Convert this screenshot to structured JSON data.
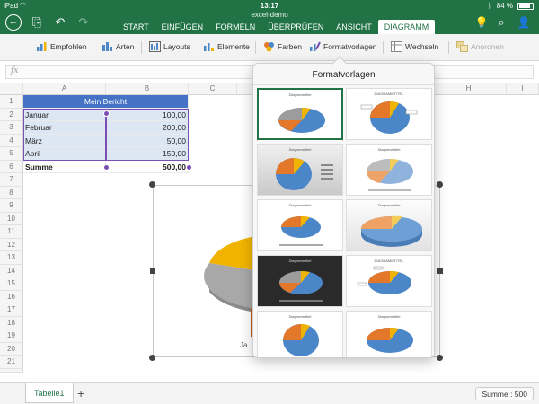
{
  "status": {
    "carrier": "iPad",
    "time": "13:17",
    "battery": "84 %"
  },
  "document": {
    "title": "excel-demo"
  },
  "tabs": [
    {
      "label": "START"
    },
    {
      "label": "EINFÜGEN"
    },
    {
      "label": "FORMELN"
    },
    {
      "label": "ÜBERPRÜFEN"
    },
    {
      "label": "ANSICHT"
    },
    {
      "label": "DIAGRAMM",
      "active": true
    }
  ],
  "ribbon": {
    "empfohlen": "Empfohlen",
    "arten": "Arten",
    "layouts": "Layouts",
    "elemente": "Elemente",
    "farben": "Farben",
    "formatvorlagen": "Formatvorlagen",
    "wechseln": "Wechseln",
    "anordnen": "Anordnen"
  },
  "formula_bar": {
    "fx": "fx",
    "value": ""
  },
  "columns": [
    "A",
    "B",
    "C",
    "D",
    "E",
    "F",
    "G",
    "H",
    "I"
  ],
  "rows": [
    "1",
    "2",
    "3",
    "4",
    "5",
    "6",
    "7",
    "8",
    "9",
    "10",
    "11",
    "12",
    "13",
    "14",
    "15",
    "16",
    "17",
    "18",
    "19",
    "20",
    "21",
    "22"
  ],
  "sheet": {
    "title": "Mein Bericht",
    "entries": [
      {
        "month": "Januar",
        "value": "100,00"
      },
      {
        "month": "Februar",
        "value": "200,00"
      },
      {
        "month": "März",
        "value": "50,00"
      },
      {
        "month": "April",
        "value": "150,00"
      }
    ],
    "sum_label": "Summe",
    "sum_value": "500,00"
  },
  "chart_legend_partial": "Ja",
  "popover": {
    "title": "Formatvorlagen",
    "styles": [
      {
        "caption": "Diagrammtitel"
      },
      {
        "caption": "DIAGRAMMTITEL"
      },
      {
        "caption": "Diagrammtitel"
      },
      {
        "caption": "Diagrammtitel"
      },
      {
        "caption": "Diagrammtitel"
      },
      {
        "caption": "Diagrammtitel"
      },
      {
        "caption": "Diagrammtitel"
      },
      {
        "caption": "DIAGRAMMTITEL"
      },
      {
        "caption": "Diagrammtitel"
      },
      {
        "caption": "Diagrammtitel"
      }
    ]
  },
  "bottom": {
    "sheet_tab": "Tabelle1",
    "add_sheet": "+",
    "sum_readout": "Summe : 500"
  },
  "colors": {
    "brand": "#217346",
    "header_fill": "#4472c4",
    "pie_blue": "#4a86c8",
    "pie_orange": "#e4782a",
    "pie_grey": "#9c9c9c",
    "pie_yellow": "#f0b400"
  }
}
